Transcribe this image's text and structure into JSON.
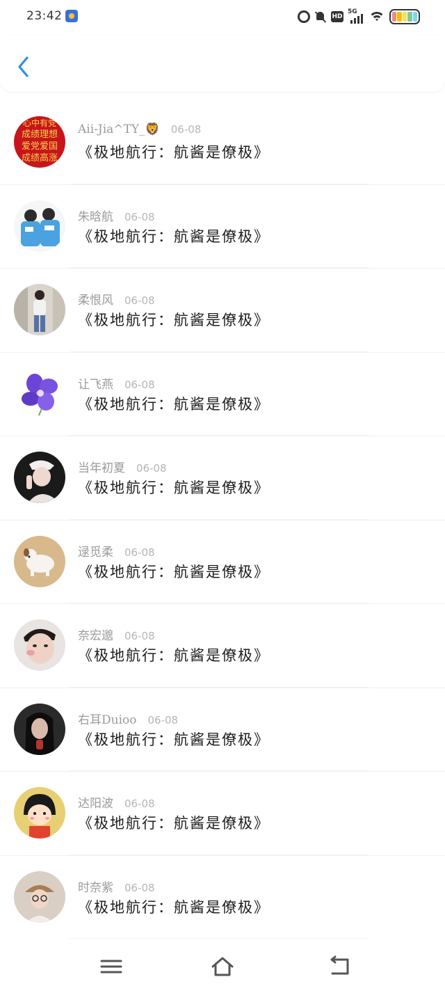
{
  "status_bar": {
    "time": "23:42",
    "hd_label": "HD",
    "network_label": "5G",
    "battery_colors": [
      "#f28b82",
      "#fbbc04",
      "#f6e05e",
      "#81c995",
      "#78d9ec"
    ]
  },
  "header": {
    "back_icon": "chevron-left-icon",
    "accent_color": "#2f8cf0"
  },
  "comments": [
    {
      "author": "Aii-Jia^TY_🦁",
      "date": "06-08",
      "text": "《极地航行：航酱是僚极》",
      "avatar": "avatar-red-banner"
    },
    {
      "author": "朱晗航",
      "date": "06-08",
      "text": "《极地航行：航酱是僚极》",
      "avatar": "avatar-two-boys-blue"
    },
    {
      "author": "柔恨风",
      "date": "06-08",
      "text": "《极地航行：航酱是僚极》",
      "avatar": "avatar-boy-street"
    },
    {
      "author": "让飞燕",
      "date": "06-08",
      "text": "《极地航行：航酱是僚极》",
      "avatar": "avatar-purple-orchid"
    },
    {
      "author": "当年初夏",
      "date": "06-08",
      "text": "《极地航行：航酱是僚极》",
      "avatar": "avatar-girl-cap"
    },
    {
      "author": "逯觅柔",
      "date": "06-08",
      "text": "《极地航行：航酱是僚极》",
      "avatar": "avatar-puppy"
    },
    {
      "author": "奈宏邈",
      "date": "06-08",
      "text": "《极地航行：航酱是僚极》",
      "avatar": "avatar-boy-face"
    },
    {
      "author": "右耳Duioo",
      "date": "06-08",
      "text": "《极地航行：航酱是僚极》",
      "avatar": "avatar-girl-dark"
    },
    {
      "author": "达阳波",
      "date": "06-08",
      "text": "《极地航行：航酱是僚极》",
      "avatar": "avatar-cartoon-girl"
    },
    {
      "author": "时奈紫",
      "date": "06-08",
      "text": "《极地航行：航酱是僚极》",
      "avatar": "avatar-girl-glasses"
    }
  ],
  "nav_bar": {
    "buttons": [
      "menu-icon",
      "home-icon",
      "back-icon"
    ]
  }
}
